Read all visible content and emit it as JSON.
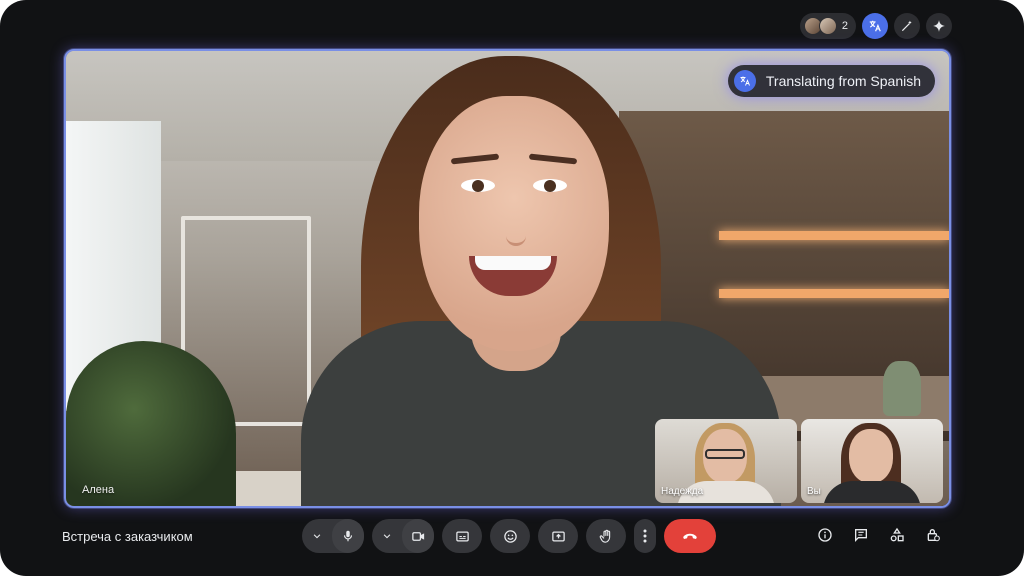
{
  "top_bar": {
    "participants_count": "2",
    "icons": [
      "people-icon",
      "translate-icon",
      "magic-pen-icon",
      "sparkle-icon"
    ]
  },
  "stage": {
    "translation_chip": "Translating from Spanish",
    "speaker_name": "Алена",
    "tiles": [
      {
        "name": "Надежда"
      },
      {
        "name": "Вы"
      }
    ]
  },
  "bottom_bar": {
    "meeting_title": "Встреча с заказчиком",
    "end_call_color": "#e3413a",
    "controls": [
      "chevron-down-icon",
      "mic-icon",
      "chevron-down-icon",
      "camera-icon",
      "captions-icon",
      "emoji-icon",
      "present-icon",
      "raise-hand-icon",
      "more-vertical-icon",
      "end-call-icon"
    ],
    "right_icons": [
      "info-icon",
      "chat-icon",
      "activities-icon",
      "host-controls-icon"
    ]
  },
  "colors": {
    "background": "#111214",
    "accent": "#4b6fe8",
    "frame_glow": "#7a8fe6"
  }
}
